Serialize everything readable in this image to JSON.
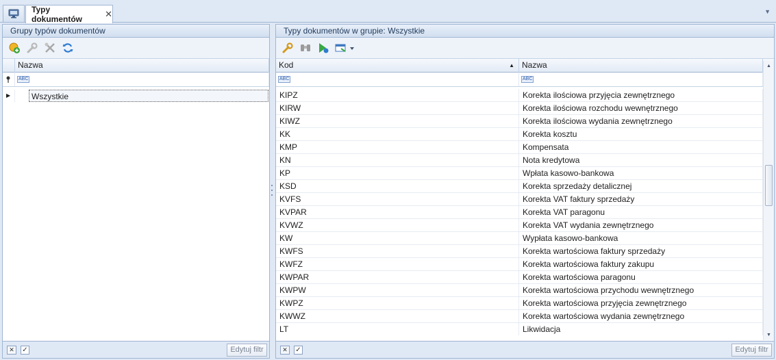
{
  "tabs": {
    "active_label": "Typy dokumentów",
    "close_glyph": "✕",
    "overflow_glyph": "▼"
  },
  "left_panel": {
    "title": "Grupy typów dokumentów",
    "toolbar": [
      "add-icon",
      "edit-wrench-icon",
      "delete-tools-icon",
      "refresh-icon"
    ],
    "column_header": "Nazwa",
    "filter_glyph": "ABC",
    "rows": [
      {
        "name": "Wszystkie",
        "selected": true
      }
    ],
    "footer": {
      "clear_glyph": "✕",
      "check_glyph": "✓",
      "edit_filter_label": "Edytuj filtr"
    }
  },
  "right_panel": {
    "title": "Typy dokumentów w grupie: Wszystkie",
    "toolbar": [
      "edit-wrench-icon",
      "binoculars-icon",
      "play-add-icon",
      "export-icon"
    ],
    "columns": {
      "code": "Kod",
      "name": "Nazwa"
    },
    "sort_glyph": "▲",
    "filter_glyph": "ABC",
    "rows": [
      {
        "code": "KIPZ",
        "name": "Korekta ilościowa przyjęcia zewnętrznego"
      },
      {
        "code": "KIRW",
        "name": "Korekta ilościowa rozchodu wewnętrznego"
      },
      {
        "code": "KIWZ",
        "name": "Korekta ilościowa wydania zewnętrznego"
      },
      {
        "code": "KK",
        "name": "Korekta kosztu"
      },
      {
        "code": "KMP",
        "name": "Kompensata"
      },
      {
        "code": "KN",
        "name": "Nota kredytowa"
      },
      {
        "code": "KP",
        "name": "Wpłata kasowo-bankowa"
      },
      {
        "code": "KSD",
        "name": "Korekta sprzedaży detalicznej"
      },
      {
        "code": "KVFS",
        "name": "Korekta VAT faktury sprzedaży"
      },
      {
        "code": "KVPAR",
        "name": "Korekta VAT paragonu"
      },
      {
        "code": "KVWZ",
        "name": "Korekta VAT wydania zewnętrznego"
      },
      {
        "code": "KW",
        "name": "Wypłata kasowo-bankowa"
      },
      {
        "code": "KWFS",
        "name": "Korekta wartościowa faktury sprzedaży"
      },
      {
        "code": "KWFZ",
        "name": "Korekta wartościowa faktury zakupu"
      },
      {
        "code": "KWPAR",
        "name": "Korekta wartościowa paragonu"
      },
      {
        "code": "KWPW",
        "name": "Korekta wartościowa przychodu wewnętrznego"
      },
      {
        "code": "KWPZ",
        "name": "Korekta wartościowa przyjęcia zewnętrznego"
      },
      {
        "code": "KWWZ",
        "name": "Korekta wartościowa wydania zewnętrznego"
      },
      {
        "code": "LT",
        "name": "Likwidacja"
      }
    ],
    "footer": {
      "clear_glyph": "✕",
      "check_glyph": "✓",
      "edit_filter_label": "Edytuj filtr"
    }
  }
}
